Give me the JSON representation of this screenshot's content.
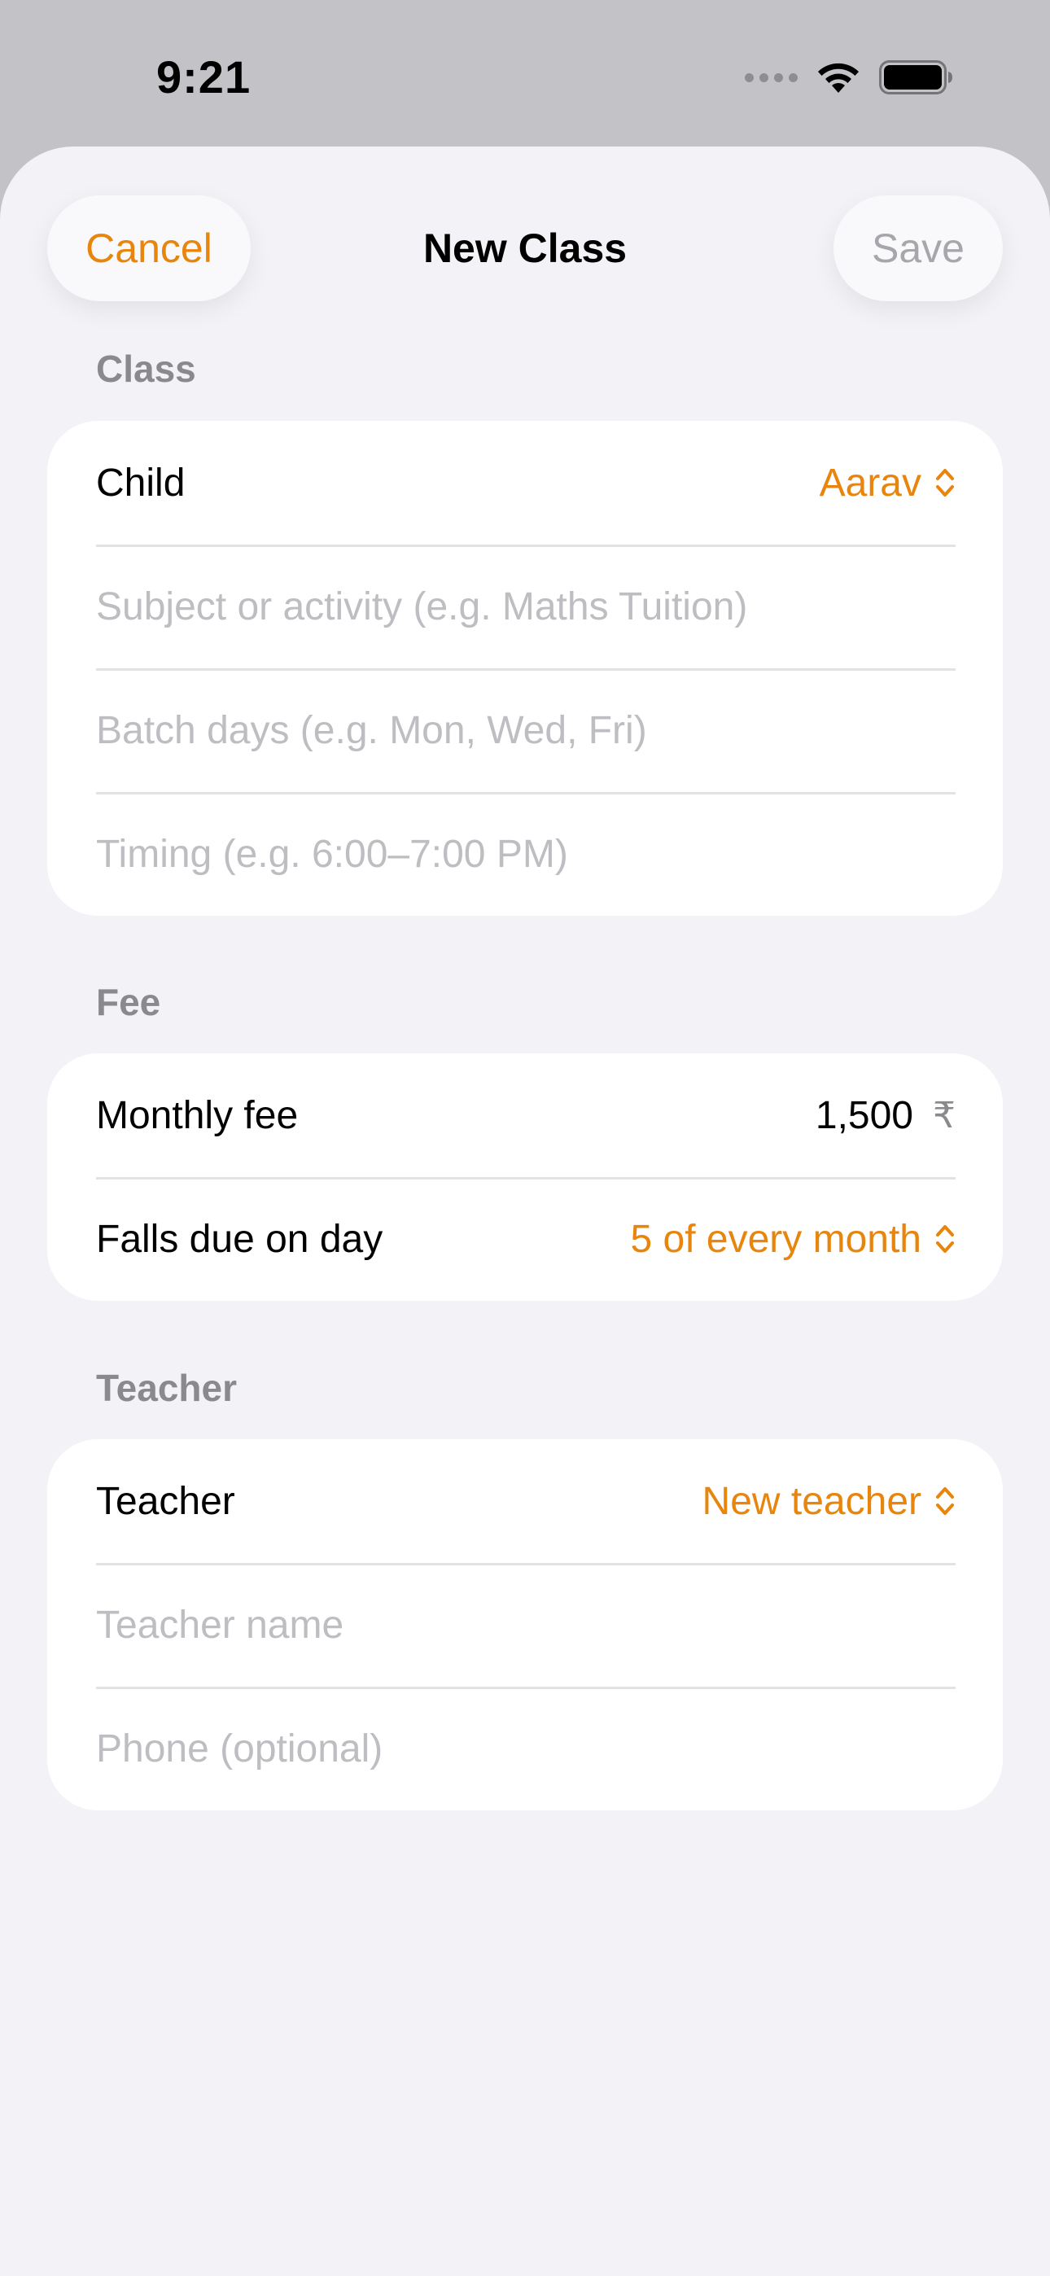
{
  "status_bar": {
    "time": "9:21"
  },
  "nav": {
    "cancel_label": "Cancel",
    "title": "New Class",
    "save_label": "Save"
  },
  "sections": {
    "class": {
      "header": "Class",
      "child_label": "Child",
      "child_value": "Aarav",
      "subject_placeholder": "Subject or activity (e.g. Maths Tuition)",
      "batch_days_placeholder": "Batch days (e.g. Mon, Wed, Fri)",
      "timing_placeholder": "Timing (e.g. 6:00–7:00 PM)"
    },
    "fee": {
      "header": "Fee",
      "monthly_fee_label": "Monthly fee",
      "monthly_fee_value": "1,500",
      "currency_symbol": "₹",
      "due_day_label": "Falls due on day",
      "due_day_value": "5 of every month"
    },
    "teacher": {
      "header": "Teacher",
      "teacher_label": "Teacher",
      "teacher_value": "New teacher",
      "name_placeholder": "Teacher name",
      "phone_placeholder": "Phone (optional)"
    }
  },
  "colors": {
    "accent": "#e8850d",
    "background": "#f2f2f7",
    "placeholder": "#bdbdc2",
    "section_header": "#8a8a8e"
  }
}
